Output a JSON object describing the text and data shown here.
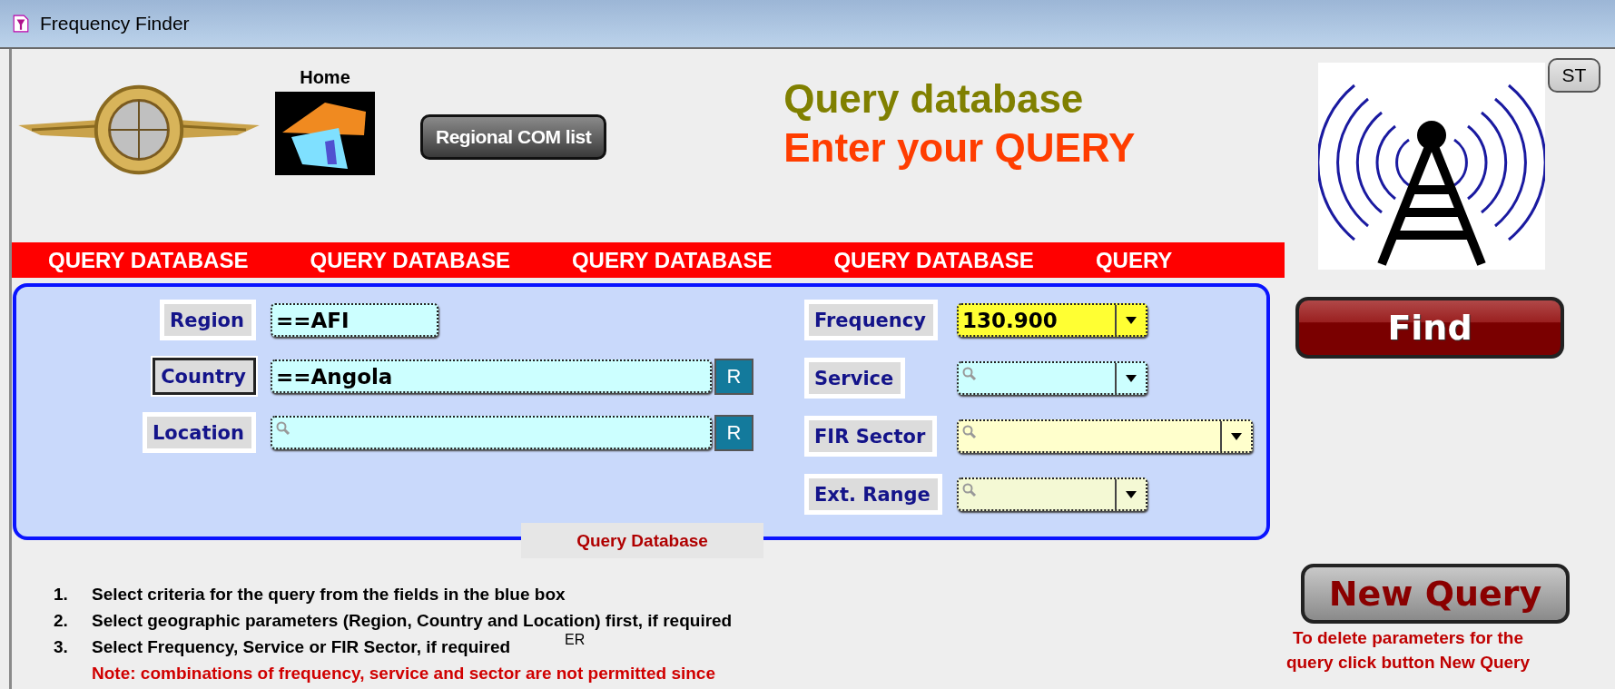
{
  "window": {
    "title": "Frequency Finder"
  },
  "header": {
    "home_label": "Home",
    "regional_button": "Regional COM list",
    "title": "Query database",
    "subtitle": "Enter your QUERY",
    "st_button": "ST"
  },
  "banner": {
    "items": [
      "QUERY DATABASE",
      "QUERY DATABASE",
      "QUERY DATABASE",
      "QUERY DATABASE",
      "QUERY"
    ]
  },
  "query_box": {
    "caption": "Query Database",
    "left_fields": [
      {
        "label": "Region",
        "value": "==AFI",
        "kind": "text",
        "focused": false,
        "color": "#ccffff"
      },
      {
        "label": "Country",
        "value": "==Angola",
        "kind": "text",
        "focused": true,
        "color": "#ccffff",
        "reset_button": "R"
      },
      {
        "label": "Location",
        "kind": "text",
        "focused": false,
        "color": "#ccffff",
        "reset_button": "R"
      }
    ],
    "right_fields": [
      {
        "label": "Frequency",
        "value": "130.900",
        "kind": "combo",
        "focused": false,
        "color": "#ffff33"
      },
      {
        "label": "Service",
        "kind": "combo",
        "focused": false,
        "color": "#ccffff"
      },
      {
        "label": "FIR Sector",
        "kind": "combo",
        "focused": false,
        "color": "#ffffcc"
      },
      {
        "label": "Ext. Range",
        "kind": "combo",
        "focused": false,
        "color": "#f4f9d4"
      }
    ]
  },
  "find_button": "Find",
  "instructions": [
    {
      "number": "1.",
      "text": "Select criteria for the query from the fields in the blue box"
    },
    {
      "number": "2.",
      "text": "Select geographic parameters (Region, Country and Location) first, if required"
    },
    {
      "number": "3.",
      "text": "Select Frequency, Service or FIR Sector, if required",
      "aside": "ER"
    }
  ],
  "note": "Note: combinations of frequency, service and sector are not permitted since",
  "new_query": {
    "label": "New Query",
    "hint": "To delete parameters for the query click button New Query"
  }
}
